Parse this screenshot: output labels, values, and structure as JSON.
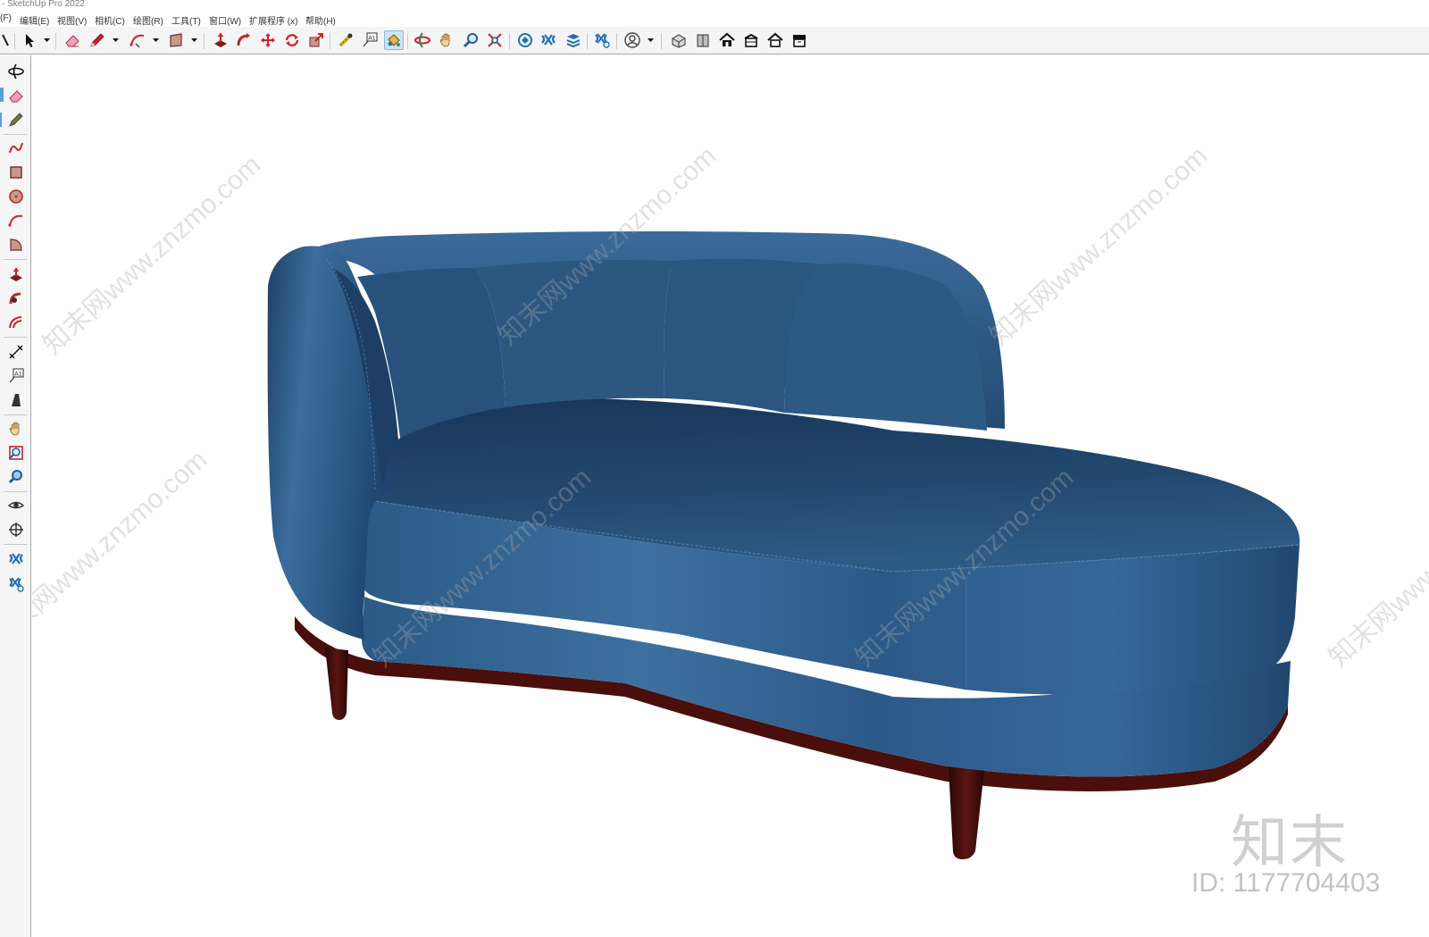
{
  "window": {
    "title": "- SketchUp Pro 2022"
  },
  "menu": [
    "(F)",
    "编辑(E)",
    "视图(V)",
    "相机(C)",
    "绘图(R)",
    "工具(T)",
    "窗口(W)",
    "扩展程序 (x)",
    "帮助(H)"
  ],
  "toolbar": {
    "active_tool": "paint-bucket",
    "tools": [
      "select",
      "eraser",
      "pencil-line",
      "arc",
      "rectangle",
      "push-pull",
      "follow-me",
      "move",
      "rotate",
      "scale",
      "tape-measure",
      "text",
      "paint-bucket",
      "orbit",
      "pan",
      "zoom",
      "zoom-extents",
      "warehouse",
      "extension-warehouse",
      "layout",
      "send-to-layout",
      "account",
      "iso-view",
      "front-view",
      "top-view",
      "right-view",
      "back-view",
      "left-view"
    ]
  },
  "left_toolbar": {
    "tools": [
      "orbit",
      "eraser",
      "paint",
      "freehand",
      "rectangle",
      "circle",
      "arc",
      "pie",
      "push-pull",
      "follow-me",
      "offset",
      "dimension",
      "text",
      "3d-text",
      "pan",
      "zoom-window",
      "zoom",
      "look-around",
      "position-camera",
      "warehouse",
      "extension-warehouse"
    ]
  },
  "colors": {
    "sofa_blue": "#2d5b85",
    "sofa_dark": "#1c3a5a",
    "sofa_highlight": "#4f80ad",
    "base_wood": "#4a0f0b",
    "toolbar_bg": "#f5f5f5"
  },
  "viewport": {
    "watermark_text": "知末网www.znzmo.com",
    "brand_logo": "知末",
    "image_id": "ID: 1177704403"
  }
}
